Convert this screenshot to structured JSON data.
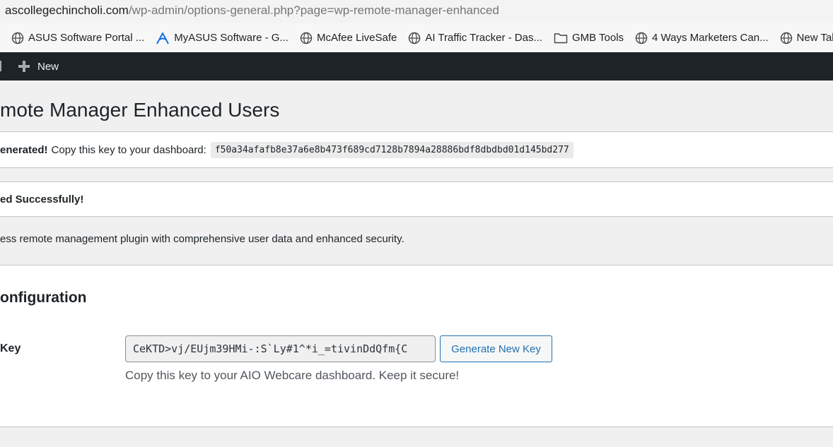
{
  "browser": {
    "url_host": "ascollegechincholi.com",
    "url_path": "/wp-admin/options-general.php?page=wp-remote-manager-enhanced",
    "bookmarks": [
      {
        "label": "ASUS Software Portal ...",
        "icon": "globe-icon"
      },
      {
        "label": "MyASUS Software - G...",
        "icon": "myasus-icon"
      },
      {
        "label": "McAfee LiveSafe",
        "icon": "globe-icon"
      },
      {
        "label": "AI Traffic Tracker - Das...",
        "icon": "globe-icon"
      },
      {
        "label": "GMB Tools",
        "icon": "folder-icon"
      },
      {
        "label": "4 Ways Marketers Can...",
        "icon": "globe-icon"
      },
      {
        "label": "New Tab",
        "icon": "globe-icon"
      }
    ]
  },
  "admin_bar": {
    "new_label": "New"
  },
  "page": {
    "title": "mote Manager Enhanced Users",
    "notice_key": {
      "strong": "enerated!",
      "text": "Copy this key to your dashboard:",
      "key": "f50a34afafb8e37a6e8b473f689cd7128b7894a28886bdf8dbdbd01d145bd277"
    },
    "notice_success": "ed Successfully!",
    "description": "ess remote management plugin with comprehensive user data and enhanced security.",
    "config": {
      "title": "onfiguration",
      "field_label": "Key",
      "key_value": "CeKTD>vj/EUjm39HMi-:S`Ly#1^*i_=tivinDdQfm{C",
      "generate_button": "Generate New Key",
      "help_text": "Copy this key to your AIO Webcare dashboard. Keep it secure!"
    }
  },
  "colors": {
    "admin_bar_bg": "#1d2327",
    "page_bg": "#f0f0f1",
    "wp_blue": "#2271b1"
  }
}
